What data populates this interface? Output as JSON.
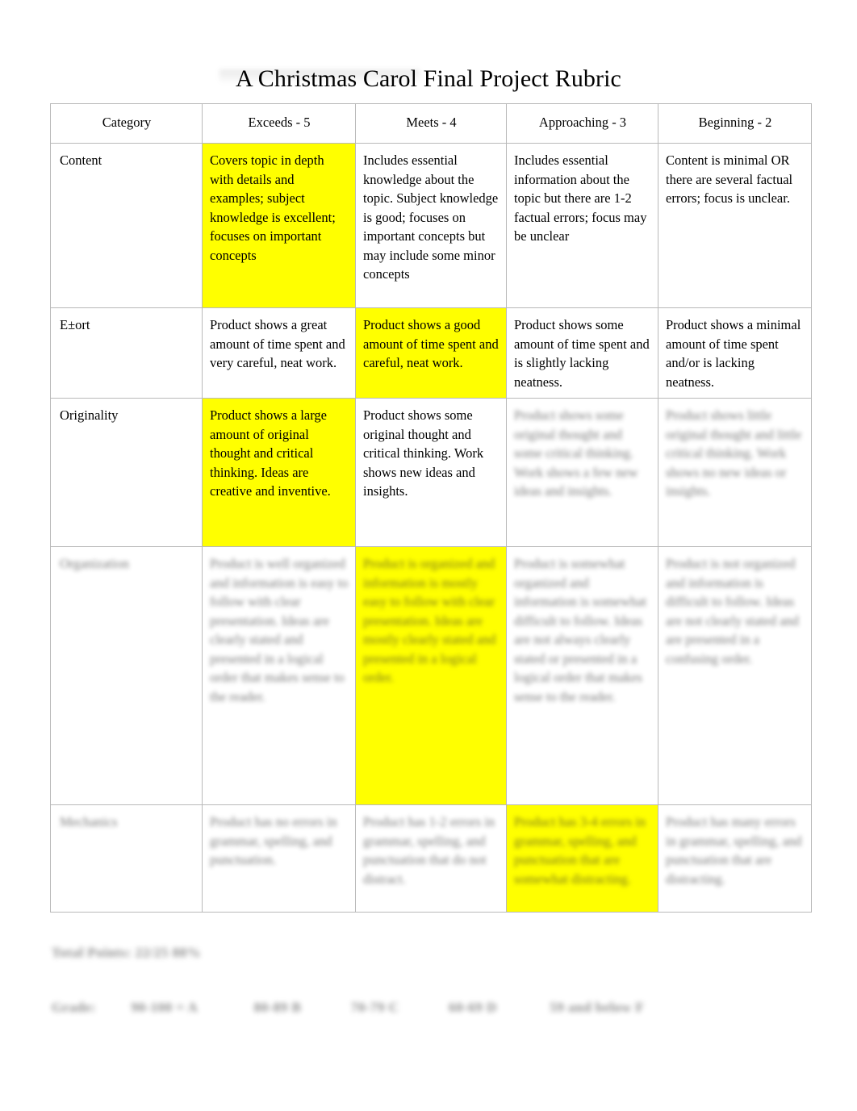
{
  "document": {
    "title": "A Christmas Carol Final Project Rubric"
  },
  "table": {
    "headers": [
      "Category",
      "Exceeds - 5",
      "Meets - 4",
      "Approaching - 3",
      "Beginning - 2"
    ],
    "rows": [
      {
        "category": "Content",
        "exceeds": "Covers topic in depth with details and examples; subject knowledge is excellent; focuses on important concepts",
        "meets": "Includes essential knowledge about the topic. Subject knowledge is good; focuses on important concepts but may include some minor concepts",
        "approaching": "Includes essential information about the topic but there are 1-2 factual errors; focus may be unclear",
        "beginning": "Content is minimal OR there are several factual errors; focus is unclear.",
        "highlight": "exceeds",
        "legible": true
      },
      {
        "category": "E±ort",
        "exceeds": "Product shows a great amount of time spent and very careful, neat work.",
        "meets": "Product shows a good amount of time spent and careful, neat work.",
        "approaching": "Product shows some amount of time spent and is slightly lacking neatness.",
        "beginning": "Product shows a minimal amount of time spent and/or is lacking neatness.",
        "highlight": "meets",
        "legible": true
      },
      {
        "category": "Originality",
        "exceeds": "Product shows a large amount of original thought and critical thinking. Ideas are creative and inventive.",
        "meets": "Product shows some original thought and critical thinking. Work shows new ideas and insights.",
        "approaching": "Product shows some original thought and some critical thinking. Work shows a few new ideas and insights.",
        "beginning": "Product shows little original thought and little critical thinking. Work shows no new ideas or insights.",
        "highlight": "exceeds",
        "legible": false,
        "illegible_cells": [
          "approaching",
          "beginning"
        ]
      },
      {
        "category": "Organization",
        "exceeds": "Product is well organized and information is easy to follow with clear presentation. Ideas are clearly stated and presented in a logical order that makes sense to the reader.",
        "meets": "Product is organized and information is mostly easy to follow with clear presentation. Ideas are mostly clearly stated and presented in a logical order.",
        "approaching": "Product is somewhat organized and information is somewhat difficult to follow. Ideas are not always clearly stated or presented in a logical order that makes sense to the reader.",
        "beginning": "Product is not organized and information is difficult to follow. Ideas are not clearly stated and are presented in a confusing order.",
        "highlight": "meets",
        "legible": false,
        "illegible_cells": [
          "category",
          "exceeds",
          "meets",
          "approaching",
          "beginning"
        ]
      },
      {
        "category": "Mechanics",
        "exceeds": "Product has no errors in grammar, spelling, and punctuation.",
        "meets": "Product has 1-2 errors in grammar, spelling, and punctuation that do not distract.",
        "approaching": "Product has 3-4 errors in grammar, spelling, and punctuation that are somewhat distracting.",
        "beginning": "Product has many errors in grammar, spelling, and punctuation that are distracting.",
        "highlight": "approaching",
        "legible": false,
        "illegible_cells": [
          "category",
          "exceeds",
          "meets",
          "approaching",
          "beginning"
        ]
      }
    ]
  },
  "footer": {
    "total_points_label": "Total Points:",
    "total_points_value": "22/25",
    "total_points_percent": "88%",
    "grade_label": "Grade:",
    "grade_scale_a": "90-100 = A",
    "grade_scale_b": "80-89 B",
    "grade_scale_c": "70-79 C",
    "grade_scale_d": "60-69 D",
    "grade_scale_f": "59 and below F",
    "legible": false
  },
  "colors": {
    "highlight": "#FFFF00",
    "border": "#B9B9B9",
    "text": "#000000",
    "page_background": "#FFFFFF"
  }
}
